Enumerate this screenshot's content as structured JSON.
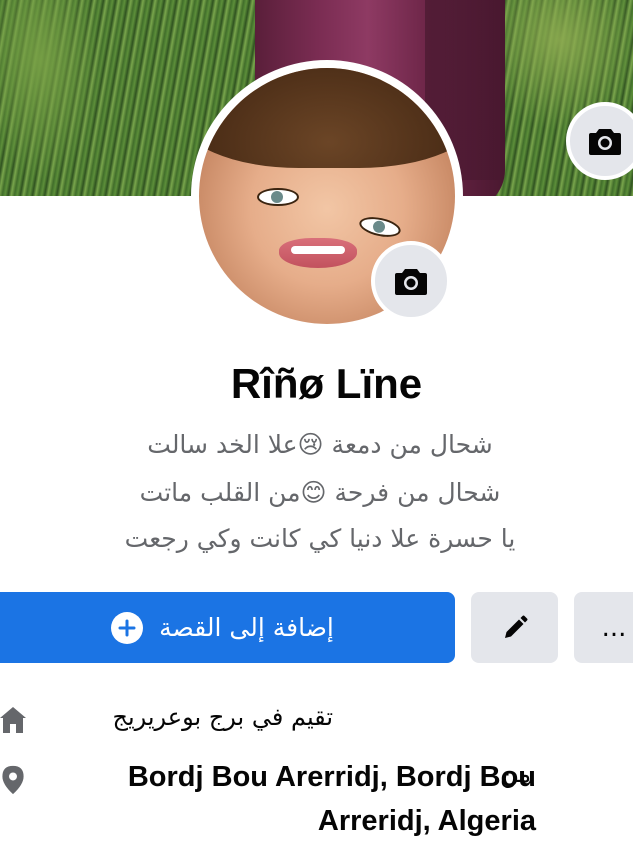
{
  "profile": {
    "name": "Rîñø Lïne",
    "bio": [
      "شحال من دمعة 😢علا الخد سالت",
      "شحال من فرحة 😊من القلب ماتت",
      "يا حسرة علا دنيا كي كانت وكي رجعت"
    ]
  },
  "actions": {
    "add_story_label": "إضافة إلى القصة",
    "more_label": "..."
  },
  "info": {
    "lives_in": "تقيم في برج بوعريريج",
    "from_prefix": "من",
    "from_value": "Bordj Bou Arerridj, Bordj Bou Arreridj, Algeria"
  },
  "colors": {
    "primary": "#1b74e4",
    "secondary_button": "#e4e6eb",
    "text_secondary": "#65676b",
    "icon_gray": "#65676b"
  },
  "icons": {
    "cover_camera": "camera-icon",
    "avatar_camera": "camera-icon",
    "add": "plus-circle-icon",
    "edit": "pencil-icon",
    "more": "more-icon",
    "home": "home-icon",
    "location": "location-pin-icon"
  }
}
